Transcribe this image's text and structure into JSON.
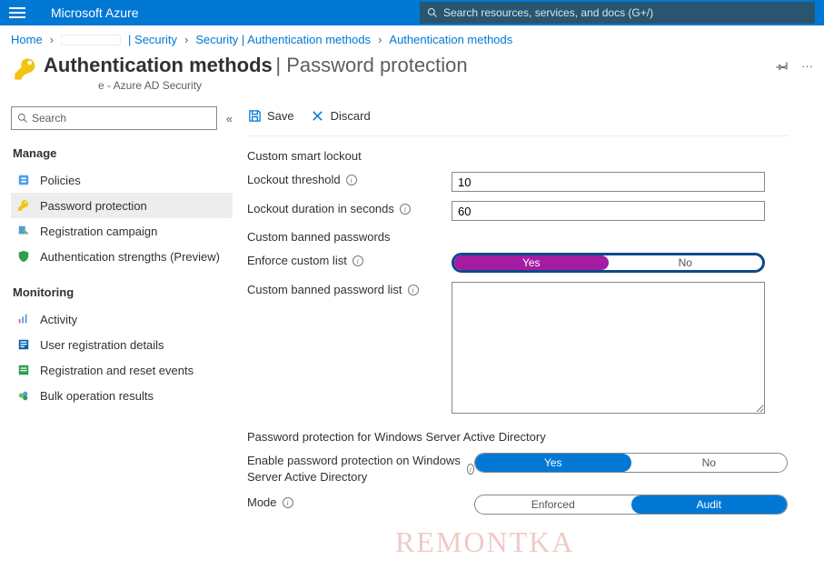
{
  "topbar": {
    "brand": "Microsoft Azure",
    "search_placeholder": "Search resources, services, and docs (G+/)"
  },
  "breadcrumb": {
    "home": "Home",
    "security": "Security",
    "auth_methods_full": "Security | Authentication methods",
    "auth_methods": "Authentication methods"
  },
  "header": {
    "title": "Authentication methods",
    "subtitle": "Password protection",
    "subline_suffix": "e - Azure AD Security"
  },
  "sidebar": {
    "search_placeholder": "Search",
    "sections": {
      "manage": {
        "label": "Manage",
        "items": [
          {
            "label": "Policies",
            "active": false
          },
          {
            "label": "Password protection",
            "active": true
          },
          {
            "label": "Registration campaign",
            "active": false
          },
          {
            "label": "Authentication strengths (Preview)",
            "active": false
          }
        ]
      },
      "monitoring": {
        "label": "Monitoring",
        "items": [
          {
            "label": "Activity"
          },
          {
            "label": "User registration details"
          },
          {
            "label": "Registration and reset events"
          },
          {
            "label": "Bulk operation results"
          }
        ]
      }
    }
  },
  "toolbar": {
    "save": "Save",
    "discard": "Discard"
  },
  "form": {
    "lockout_heading": "Custom smart lockout",
    "lockout_threshold_label": "Lockout threshold",
    "lockout_threshold_value": "10",
    "lockout_duration_label": "Lockout duration in seconds",
    "lockout_duration_value": "60",
    "banned_heading": "Custom banned passwords",
    "enforce_label": "Enforce custom list",
    "enforce_yes": "Yes",
    "enforce_no": "No",
    "banned_list_label": "Custom banned password list",
    "ad_heading": "Password protection for Windows Server Active Directory",
    "ad_enable_label": "Enable password protection on Windows Server Active Directory",
    "ad_yes": "Yes",
    "ad_no": "No",
    "mode_label": "Mode",
    "mode_enforced": "Enforced",
    "mode_audit": "Audit"
  },
  "watermark": "REMONTKA"
}
